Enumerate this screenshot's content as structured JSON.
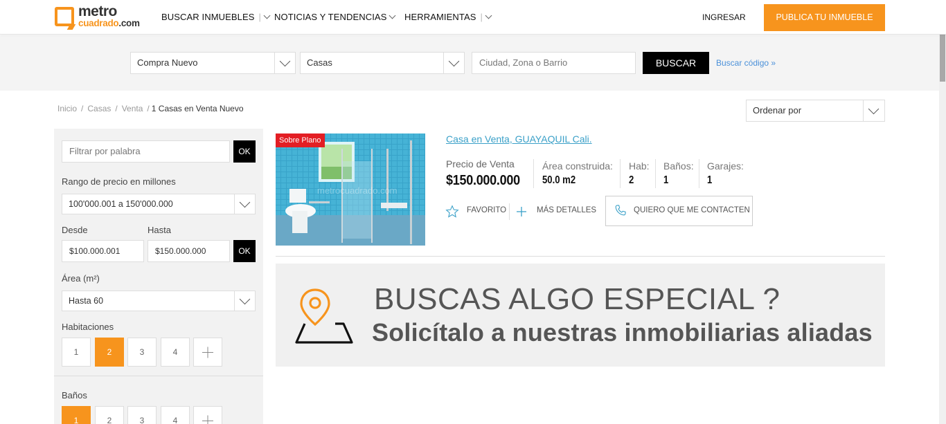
{
  "header": {
    "logo": {
      "line1": "metro",
      "line2": "cuadrado",
      "line2_suffix": ".com"
    },
    "nav": [
      {
        "label": "BUSCAR INMUEBLES"
      },
      {
        "label": "NOTICIAS Y TENDENCIAS"
      },
      {
        "label": "HERRAMIENTAS"
      }
    ],
    "nav_separator": "|",
    "login_label": "INGRESAR",
    "publish_label": "PUBLICA TU INMUEBLE"
  },
  "search": {
    "operation_value": "Compra Nuevo",
    "property_type_value": "Casas",
    "location_placeholder": "Ciudad, Zona o Barrio",
    "search_label": "BUSCAR",
    "code_link": "Buscar código »"
  },
  "breadcrumb": {
    "items": [
      "Inicio",
      "Casas",
      "Venta"
    ],
    "separator": "/",
    "current": "1 Casas en Venta Nuevo"
  },
  "sort": {
    "value": "Ordenar por"
  },
  "sidebar": {
    "keyword_placeholder": "Filtrar por palabra",
    "ok_label": "OK",
    "price_range_label": "Rango de precio en millones",
    "price_range_value": "100'000.001 a 150'000.000",
    "from_label": "Desde",
    "to_label": "Hasta",
    "from_value": "$100.000.001",
    "to_value": "$150.000.000",
    "area_label": "Área (m²)",
    "area_value": "Hasta 60",
    "rooms_label": "Habitaciones",
    "rooms_options": [
      "1",
      "2",
      "3",
      "4"
    ],
    "rooms_selected": "2",
    "baths_label": "Baños",
    "baths_options": [
      "1",
      "2",
      "3",
      "4"
    ],
    "baths_selected": "1"
  },
  "listing": {
    "badge": "Sobre Plano",
    "title": "Casa en Venta, GUAYAQUIL Cali.",
    "price_label": "Precio de Venta",
    "price_value": "$150.000.000",
    "specs": [
      {
        "label": "Área construida:",
        "value": "50.0 m2"
      },
      {
        "label": "Hab:",
        "value": "2"
      },
      {
        "label": "Baños:",
        "value": "1"
      },
      {
        "label": "Garajes:",
        "value": "1"
      }
    ],
    "favorite_label": "FAVORITO",
    "details_label": "MÁS DETALLES",
    "contact_label": "QUIERO QUE ME CONTACTEN",
    "watermark": "metrocuadrado.com"
  },
  "banner": {
    "heading": "BUSCAS ALGO ESPECIAL ?",
    "subheading": "Solicítalo a nuestras inmobiliarias aliadas"
  },
  "colors": {
    "brand_orange": "#f7941d",
    "link_blue": "#3aa0c8",
    "badge_red": "#e31e24"
  }
}
